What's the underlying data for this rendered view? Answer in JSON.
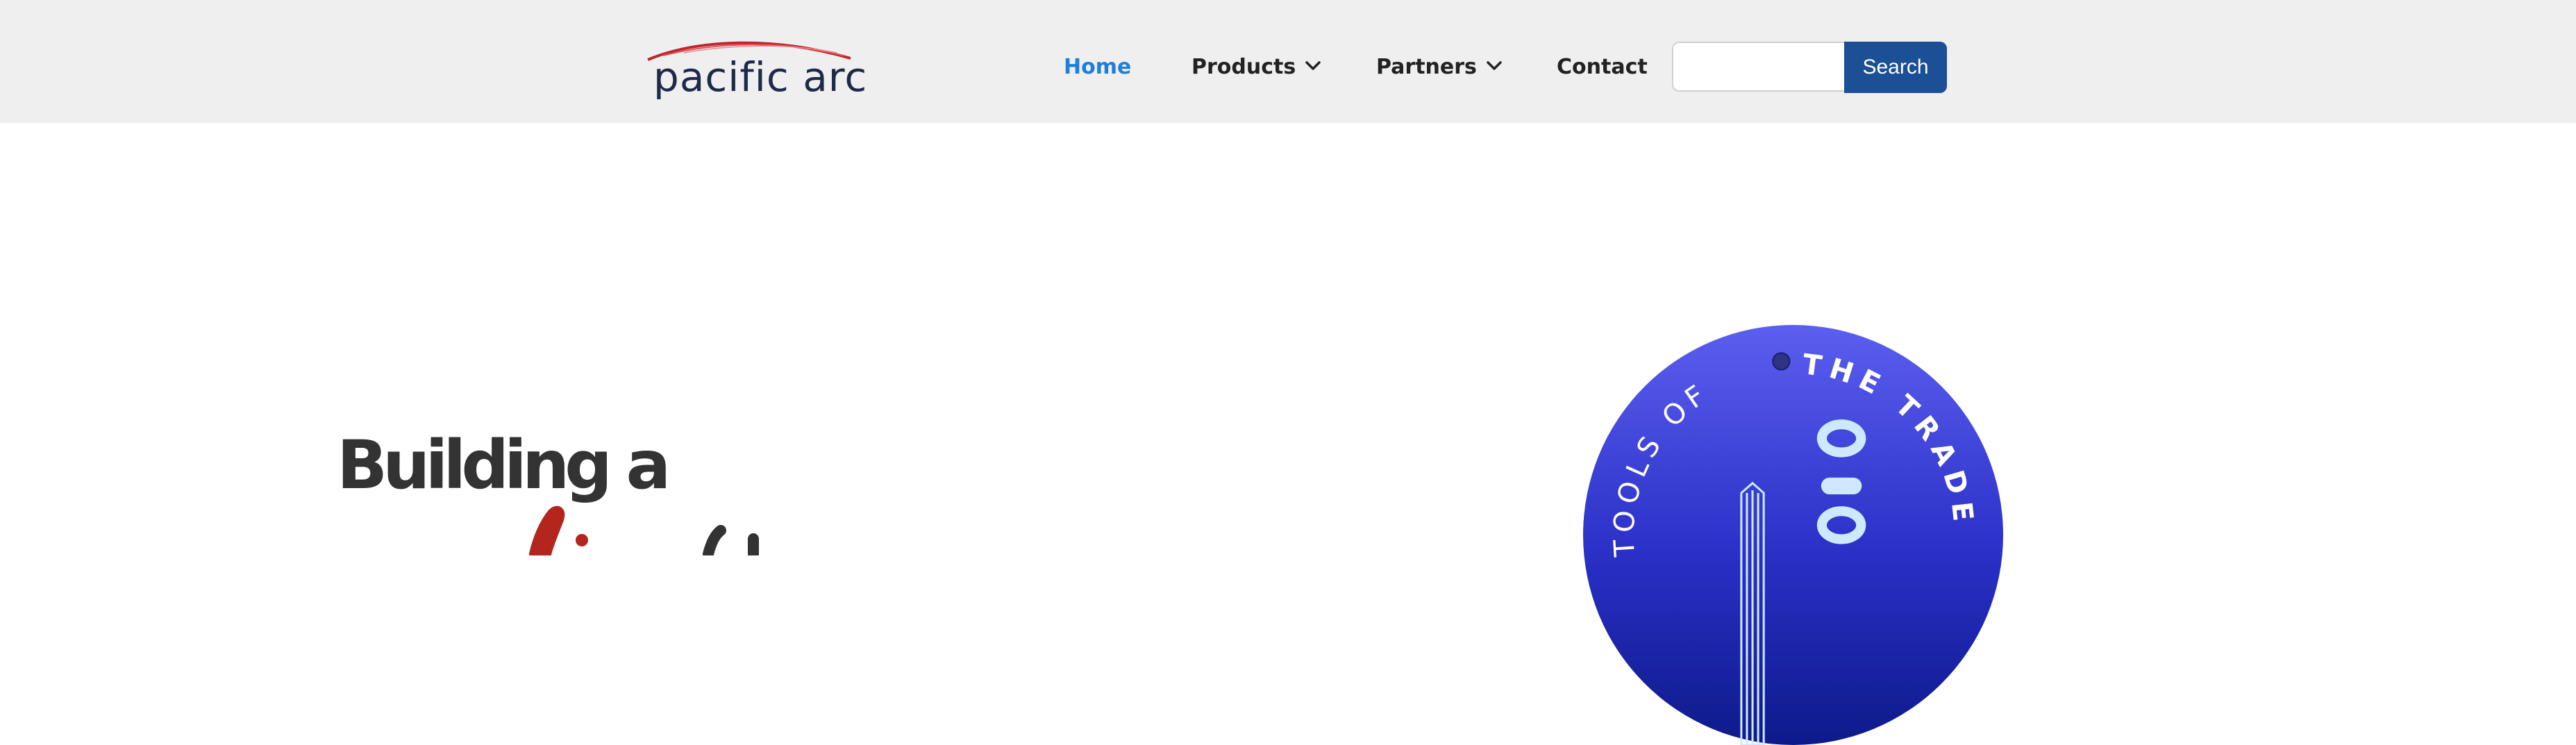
{
  "brand": {
    "name": "pacific arc",
    "swoosh_color": "#c0262c"
  },
  "nav": {
    "items": [
      {
        "label": "Home",
        "active": true,
        "has_dropdown": false
      },
      {
        "label": "Products",
        "active": false,
        "has_dropdown": true
      },
      {
        "label": "Partners",
        "active": false,
        "has_dropdown": true
      },
      {
        "label": "Contact",
        "active": false,
        "has_dropdown": false
      }
    ]
  },
  "search": {
    "placeholder": "",
    "value": "",
    "button_label": "Search"
  },
  "hero": {
    "line1": "Building a",
    "accent_color": "#b3261e"
  },
  "badge": {
    "text_left": "TOOLS OF",
    "text_right": "THE TRADE",
    "gradient_top": "#5b5ff0",
    "gradient_bottom": "#0d1a8a"
  },
  "colors": {
    "header_bg": "#efefef",
    "nav_active": "#1e7fd8",
    "search_button": "#1b4f96"
  }
}
